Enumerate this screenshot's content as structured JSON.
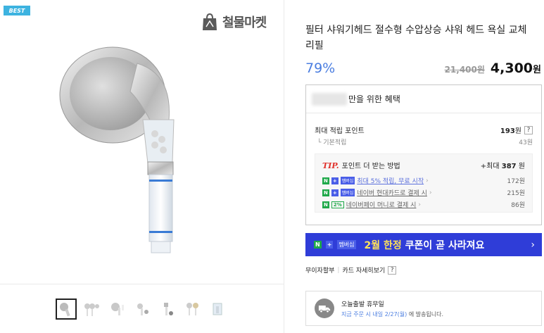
{
  "badge": "BEST",
  "brand": {
    "name": "철물마켓"
  },
  "thumbnails": [
    "thumb-1",
    "thumb-2",
    "thumb-3",
    "thumb-4",
    "thumb-5",
    "thumb-6",
    "thumb-7"
  ],
  "product": {
    "title": "필터 샤워기헤드 절수형 수압상승 샤워 헤드 욕실 교체 리필",
    "discount": "79%",
    "original_price": "21,400원",
    "sale_price": "4,300",
    "sale_unit": "원"
  },
  "benefit": {
    "title": "만을 위한 혜택",
    "max_points_label": "최대 적립 포인트",
    "max_points_value": "193",
    "max_points_unit": "원",
    "help": "?",
    "basic_label": "기본적립",
    "basic_value": "43원",
    "tip": {
      "tip_word": "TIP.",
      "label": "포인트 더 받는 방법",
      "max_prefix": "+최대",
      "max_value": "387",
      "max_unit": "원",
      "rows": [
        {
          "badge1": "N",
          "badge2": "+",
          "badge3": "멤버십",
          "text": "최대 5% 적립, 무료 시작",
          "amount": "172원"
        },
        {
          "badge1": "N",
          "badge2": "+",
          "badge3": "멤버십",
          "text": "네이버 현대카드로 결제 시",
          "amount": "215원"
        },
        {
          "badge1": "N",
          "badge2": "2%",
          "text": "네이버페이 머니로 결제 시",
          "amount": "86원"
        }
      ]
    }
  },
  "banner": {
    "n": "N",
    "plus": "+",
    "membership": "멤버십",
    "highlight": "2월 한정",
    "text": " 쿠폰이 곧 사라져요",
    "arrow": "›"
  },
  "installment": {
    "label": "무이자할부",
    "card_label": "카드 자세히보기",
    "help": "?"
  },
  "shipping": {
    "title": "오늘출발 휴무일",
    "desc_highlight": "지금 주문 시 내일 2/27(월)",
    "desc_rest": "에 발송됩니다."
  },
  "colors": {
    "accent": "#4a7de0",
    "banner": "#2f3dd8",
    "naver_green": "#1fa94a",
    "tip_red": "#e0312b"
  }
}
